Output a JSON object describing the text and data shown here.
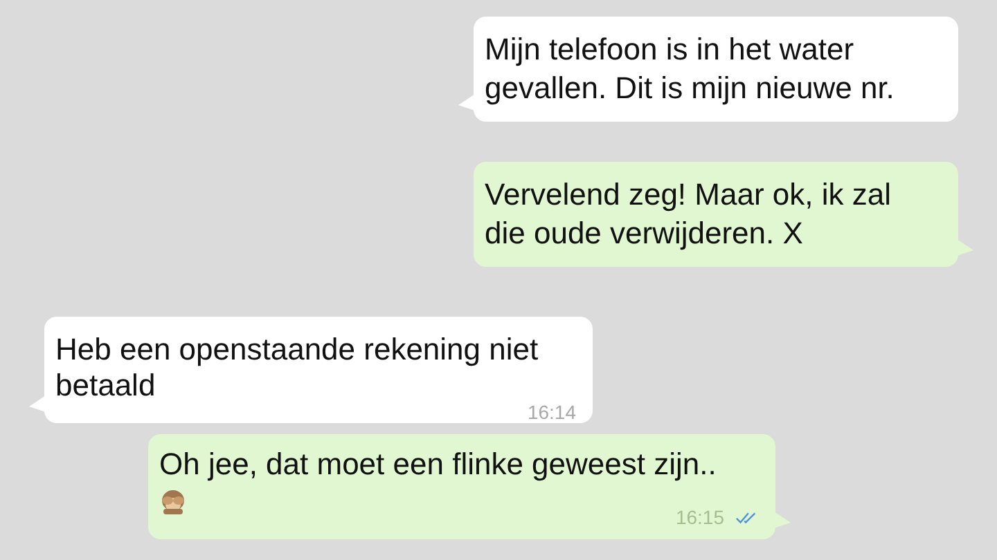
{
  "messages": [
    {
      "kind": "incoming",
      "text": "Mijn telefoon is in het water gevallen. Dit is mijn nieuwe nr."
    },
    {
      "kind": "outgoing",
      "text": "Vervelend zeg! Maar ok, ik zal die oude verwijderen. X"
    },
    {
      "kind": "incoming",
      "text": "Heb een openstaande rekening niet betaald",
      "time": "16:14"
    },
    {
      "kind": "outgoing",
      "text": "Oh jee, dat moet een flinke geweest zijn..",
      "emoji": true,
      "time": "16:15",
      "read": true
    }
  ]
}
